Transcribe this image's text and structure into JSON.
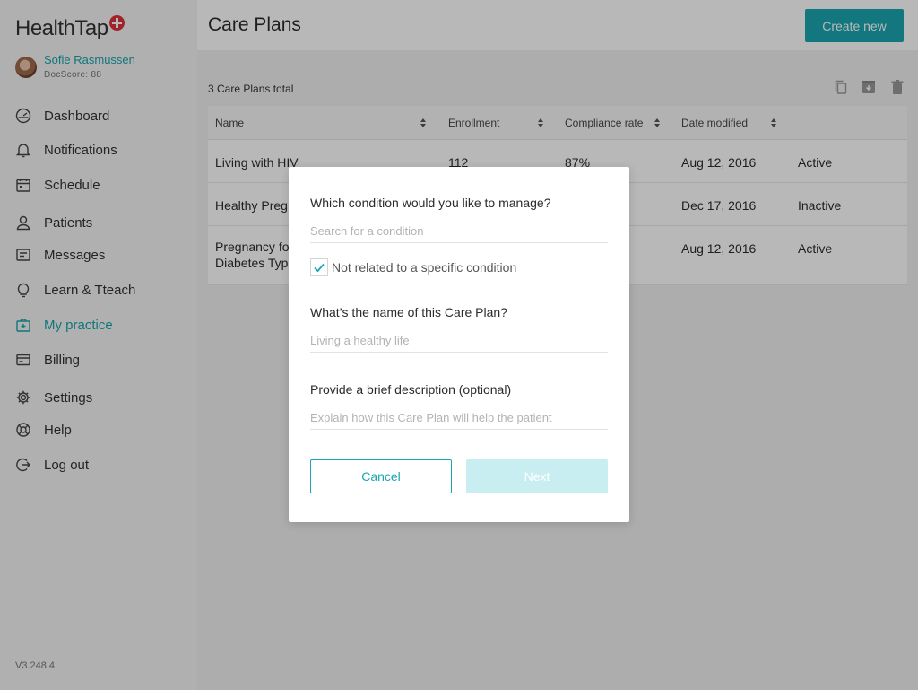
{
  "app": {
    "logo_text": "HealthTap",
    "brand_color": "#e0303a",
    "accent_color": "#1aa6b0",
    "version": "V3.248.4"
  },
  "profile": {
    "name": "Sofie Rasmussen",
    "score": "DocScore: 88"
  },
  "sidebar": {
    "items": [
      {
        "label": "Dashboard",
        "icon": "dashboard-icon"
      },
      {
        "label": "Notifications",
        "icon": "bell-icon"
      },
      {
        "label": "Schedule",
        "icon": "calendar-icon"
      },
      {
        "label": "Patients",
        "icon": "person-icon"
      },
      {
        "label": "Messages",
        "icon": "message-icon"
      },
      {
        "label": "Learn & Tteach",
        "icon": "lightbulb-icon"
      },
      {
        "label": "My practice",
        "icon": "practice-icon",
        "active": true
      },
      {
        "label": "Billing",
        "icon": "card-icon"
      },
      {
        "label": "Settings",
        "icon": "gear-icon"
      },
      {
        "label": "Help",
        "icon": "lifebuoy-icon"
      },
      {
        "label": "Log out",
        "icon": "logout-icon"
      }
    ]
  },
  "header": {
    "title": "Care Plans",
    "create_label": "Create new"
  },
  "list": {
    "total_text": "3 Care Plans total",
    "toolbar_icons": [
      "copy-icon",
      "archive-icon",
      "trash-icon"
    ],
    "columns": [
      "Name",
      "Enrollment",
      "Compliance rate",
      "Date modified"
    ],
    "rows": [
      {
        "name": "Living with HIV",
        "enrollment": "112",
        "compliance": "87%",
        "date": "Aug 12, 2016",
        "status": "Active"
      },
      {
        "name": "Healthy Preg",
        "enrollment": "",
        "compliance": "",
        "date": "Dec 17, 2016",
        "status": "Inactive"
      },
      {
        "name": "Pregnancy fo",
        "name_line2": "Diabetes Typ",
        "enrollment": "",
        "compliance": "",
        "date": "Aug 12, 2016",
        "status": "Active"
      }
    ]
  },
  "modal": {
    "condition_question": "Which condition would you like to manage?",
    "condition_placeholder": "Search for a condition",
    "checkbox_label": "Not related to a specific condition",
    "checkbox_checked": true,
    "name_question": "What’s the name of this Care Plan?",
    "name_placeholder": "Living a healthy life",
    "description_question": "Provide a brief description (optional)",
    "description_placeholder": "Explain how this Care Plan will help the patient",
    "cancel_label": "Cancel",
    "next_label": "Next"
  }
}
